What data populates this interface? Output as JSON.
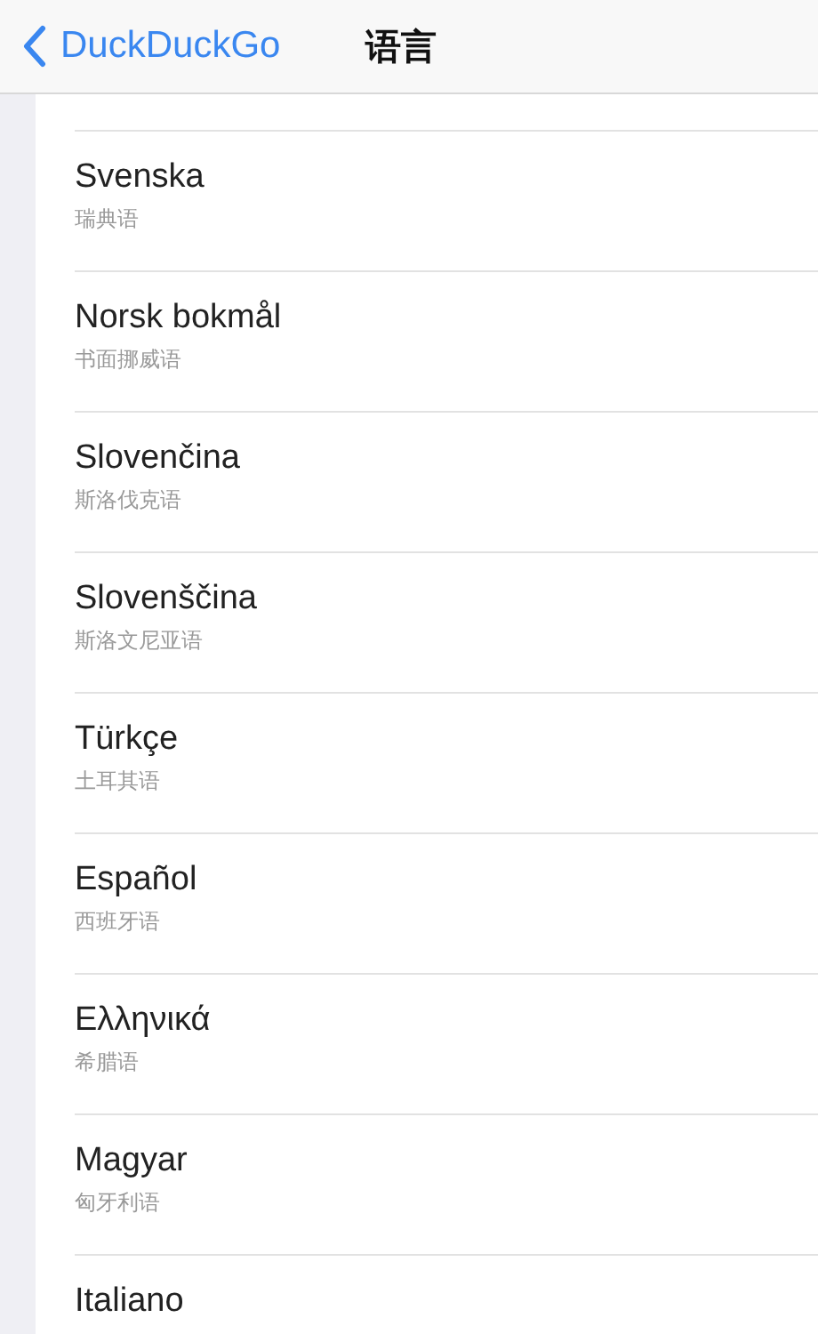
{
  "nav": {
    "back_label": "DuckDuckGo",
    "title": "语言"
  },
  "languages": [
    {
      "name": "Svenska",
      "subtitle": "瑞典语"
    },
    {
      "name": "Norsk bokmål",
      "subtitle": "书面挪威语"
    },
    {
      "name": "Slovenčina",
      "subtitle": "斯洛伐克语"
    },
    {
      "name": "Slovenščina",
      "subtitle": "斯洛文尼亚语"
    },
    {
      "name": "Türkçe",
      "subtitle": "土耳其语"
    },
    {
      "name": "Español",
      "subtitle": "西班牙语"
    },
    {
      "name": "Ελληνικά",
      "subtitle": "希腊语"
    },
    {
      "name": "Magyar",
      "subtitle": "匈牙利语"
    },
    {
      "name": "Italiano"
    }
  ]
}
